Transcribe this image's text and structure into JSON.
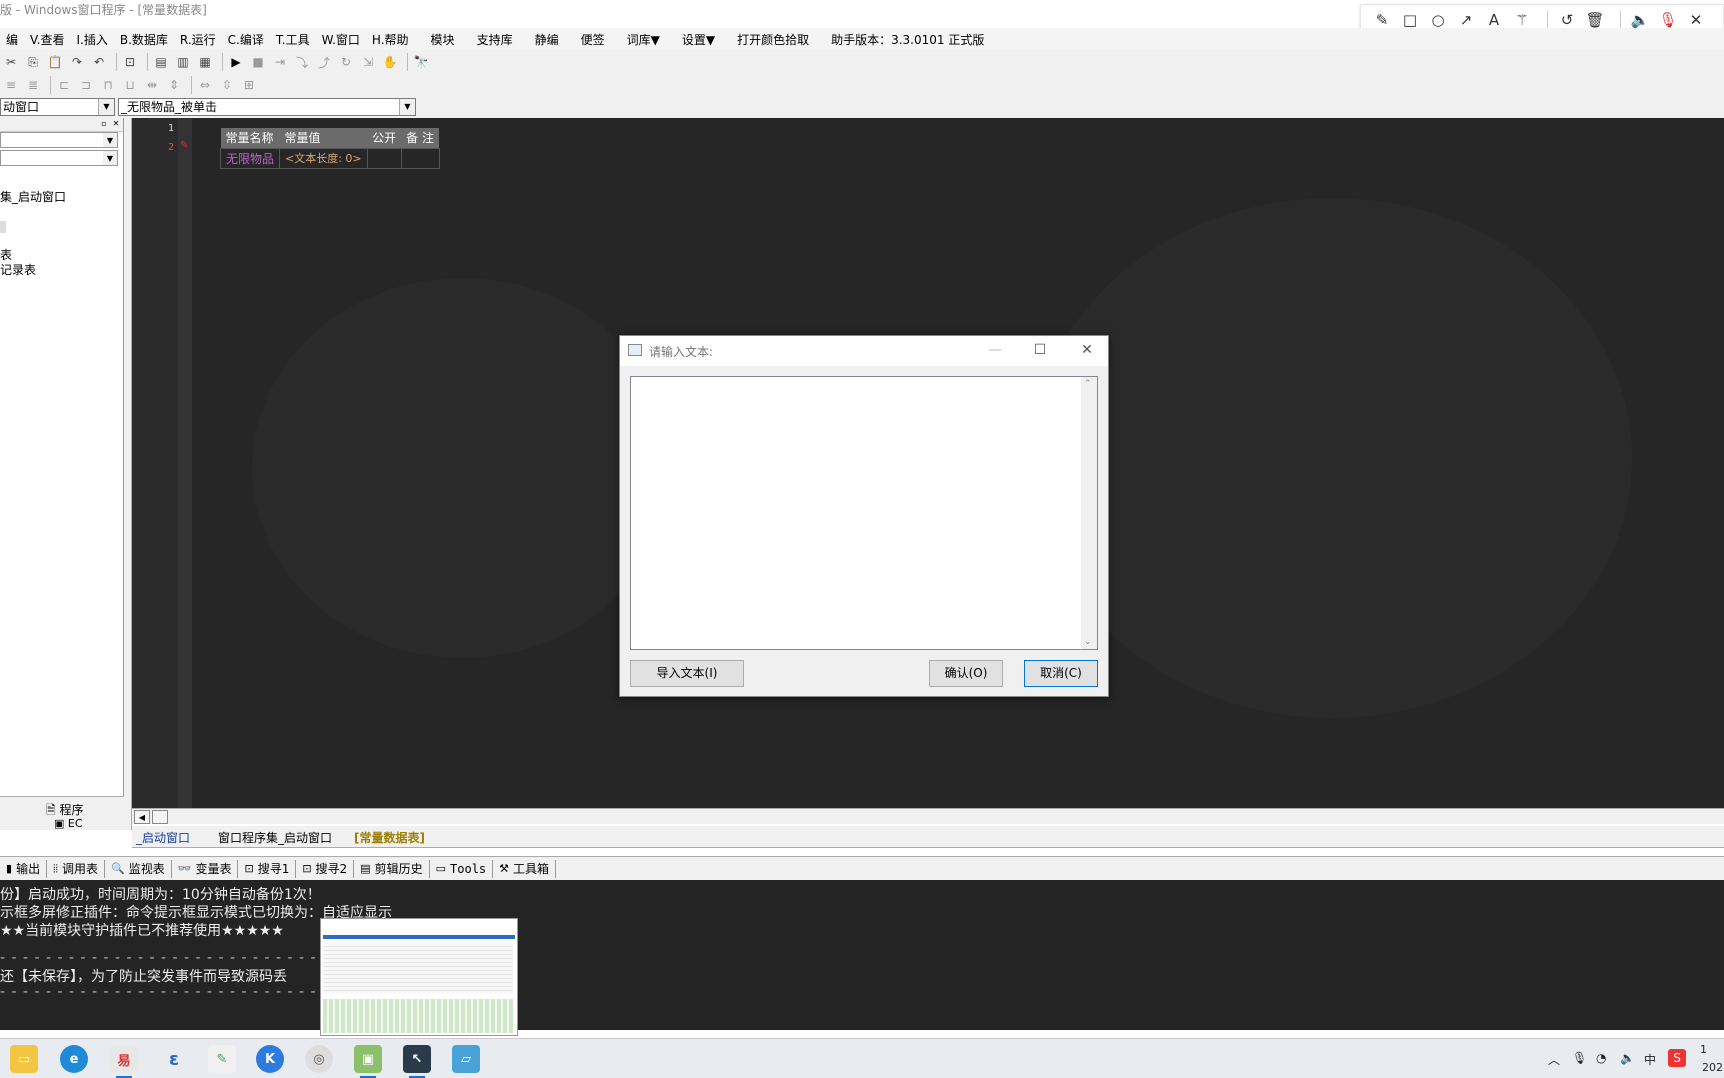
{
  "window": {
    "title": "版 - Windows窗口程序 - [常量数据表]"
  },
  "menu": [
    {
      "label": "编"
    },
    {
      "label": "V.查看"
    },
    {
      "label": "I.插入"
    },
    {
      "label": "B.数据库"
    },
    {
      "label": "R.运行"
    },
    {
      "label": "C.编译"
    },
    {
      "label": "T.工具"
    },
    {
      "label": "W.窗口"
    },
    {
      "label": "H.帮助"
    },
    {
      "label": "模块"
    },
    {
      "label": "支持库"
    },
    {
      "label": "静编"
    },
    {
      "label": "便签"
    },
    {
      "label": "词库▼"
    },
    {
      "label": "设置▼"
    },
    {
      "label": "打开颜色拾取"
    },
    {
      "label": "助手版本：3.3.0101 正式版"
    }
  ],
  "combos": {
    "object": "动窗口",
    "event": "_无限物品_被单击"
  },
  "left_panel": {
    "tree_items": [
      "集_启动窗口",
      "表",
      "记录表"
    ],
    "tabs": {
      "program": "程序",
      "ec": "EC"
    }
  },
  "editor": {
    "line_numbers": [
      "1",
      "2"
    ],
    "table": {
      "headers": [
        "常量名称",
        "常量值",
        "公开",
        "备 注"
      ],
      "rows": [
        {
          "name": "无限物品",
          "value": "<文本长度: 0>",
          "public": "",
          "note": ""
        }
      ]
    },
    "name_color": "#c060d0",
    "value_color": "#d8a878"
  },
  "doc_tabs": [
    "_启动窗口",
    "窗口程序集_启动窗口",
    "[常量数据表]"
  ],
  "output_tabs": [
    {
      "label": "输出",
      "icon": "output-icon"
    },
    {
      "label": "调用表",
      "icon": "call-table-icon"
    },
    {
      "label": "监视表",
      "icon": "magnifier-icon"
    },
    {
      "label": "变量表",
      "icon": "glasses-icon"
    },
    {
      "label": "搜寻1",
      "icon": "search1-icon"
    },
    {
      "label": "搜寻2",
      "icon": "search2-icon"
    },
    {
      "label": "剪辑历史",
      "icon": "clipboard-icon"
    },
    {
      "label": "Tools",
      "icon": "tools-icon"
    },
    {
      "label": "工具箱",
      "icon": "toolbox-icon"
    }
  ],
  "output": {
    "lines": [
      "份】启动成功，时间周期为：10分钟自动备份1次！",
      "示框多屏修正插件：命令提示框显示模式已切换为：自适应显示",
      "★★当前模块守护插件已不推荐使用★★★★★"
    ],
    "dash1": "- - - - - - - - - - - - - - - - - - - - - - - - - - - - - - - - - - - -",
    "warn": "还【未保存】，为了防止突发事件而导致源码丢",
    "dash2": "- - - - - - - - - - - - - - - - - - - - - - - - - - - - - - - - - - - -"
  },
  "dialog": {
    "title": "请输入文本:",
    "import_label": "导入文本(I)",
    "ok_label": "确认(O)",
    "cancel_label": "取消(C)",
    "text_value": ""
  },
  "tray": {
    "ime": "中",
    "clock_top": "1",
    "clock_bottom": "202"
  }
}
